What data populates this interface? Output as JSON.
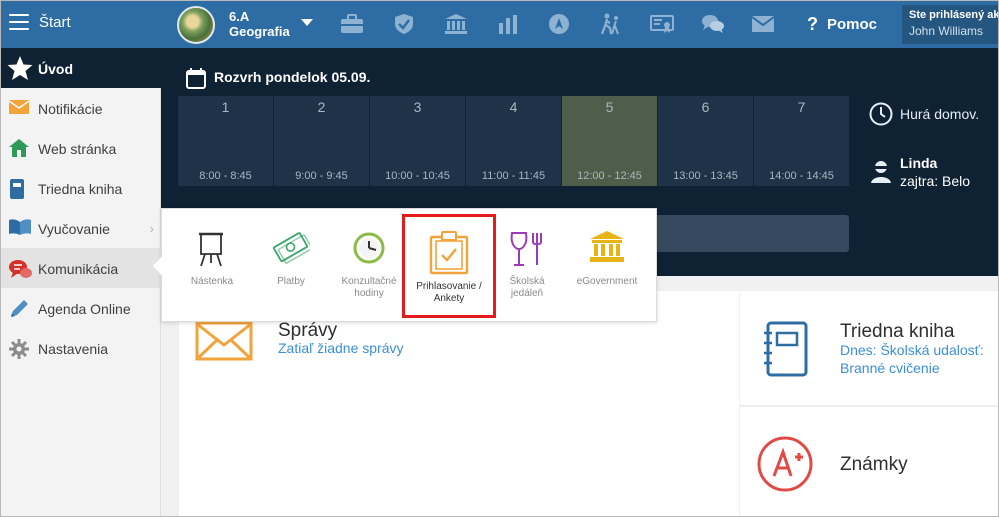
{
  "topbar": {
    "start_label": "Štart",
    "class_code": "6.A",
    "class_subject": "Geografia",
    "help_label": "Pomoc",
    "help_glyph": "?",
    "user_status": "Ste prihlásený ako",
    "user_name": "John Williams",
    "icons": [
      "briefcase-icon",
      "shield-check-icon",
      "institution-icon",
      "bar-chart-icon",
      "compass-icon",
      "walking-icon",
      "certificate-icon",
      "chat-icon",
      "envelope-icon"
    ]
  },
  "schedule": {
    "title": "Rozvrh pondelok 05.09.",
    "slots": [
      {
        "num": "1",
        "time": "8:00 - 8:45"
      },
      {
        "num": "2",
        "time": "9:00 - 9:45"
      },
      {
        "num": "3",
        "time": "10:00 - 10:45"
      },
      {
        "num": "4",
        "time": "11:00 - 11:45"
      },
      {
        "num": "5",
        "time": "12:00 - 12:45"
      },
      {
        "num": "6",
        "time": "13:00 - 13:45"
      },
      {
        "num": "7",
        "time": "14:00 - 14:45"
      }
    ],
    "current_slot": "5",
    "end_text": "Hurá domov.",
    "person_name": "Linda",
    "person_tomorrow": "zajtra: Belo"
  },
  "sidebar": {
    "home_label": "Úvod",
    "items": [
      {
        "label": "Notifikácie",
        "icon": "envelope-icon"
      },
      {
        "label": "Web stránka",
        "icon": "house-icon"
      },
      {
        "label": "Triedna kniha",
        "icon": "book-icon"
      },
      {
        "label": "Vyučovanie",
        "icon": "open-book-icon"
      },
      {
        "label": "Komunikácia",
        "icon": "chat-bubbles-icon"
      },
      {
        "label": "Agenda Online",
        "icon": "pen-icon"
      },
      {
        "label": "Nastavenia",
        "icon": "gear-icon"
      }
    ],
    "chevron": "›"
  },
  "popup": {
    "items": [
      {
        "label": "Nástenka",
        "icon": "easel-icon"
      },
      {
        "label": "Platby",
        "icon": "money-icon"
      },
      {
        "label": "Konzultačné hodiny",
        "icon": "clock-icon"
      },
      {
        "label": "Prihlasovanie / Ankety",
        "icon": "clipboard-check-icon"
      },
      {
        "label": "Školská jedáleň",
        "icon": "dining-icon"
      },
      {
        "label": "eGovernment",
        "icon": "government-icon"
      }
    ]
  },
  "cards": {
    "messages_title": "Správy",
    "messages_sub": "Zatiaľ žiadne správy",
    "diary_title": "Triedna kniha",
    "diary_event_line1": "Dnes: Školská udalosť:",
    "diary_event_line2": "Branné cvičenie",
    "grades_title": "Známky"
  },
  "colors": {
    "topbar": "#2e6da3",
    "dark": "#0e2233",
    "slot": "#1e3347",
    "slot_current": "#4f5d4b",
    "link": "#3b8fd6",
    "highlight_border": "#e51b1b",
    "orange": "#f2a33a"
  }
}
